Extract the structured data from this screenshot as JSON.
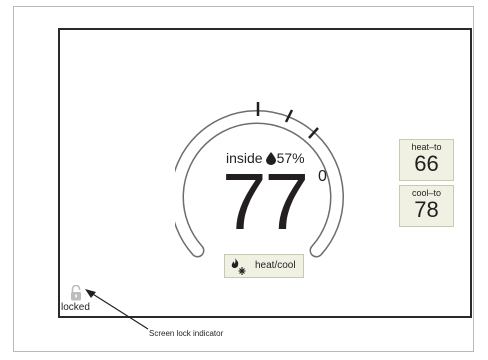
{
  "thermostat": {
    "inside_label": "inside",
    "humidity": "57%",
    "current_temp": "77",
    "temp_unit": "0",
    "heat_to": {
      "label": "heat–to",
      "value": "66"
    },
    "cool_to": {
      "label": "cool–to",
      "value": "78"
    },
    "mode": {
      "label": "heat/cool",
      "icon": "flame-snowflake-icon"
    }
  },
  "lock": {
    "label": "locked",
    "icon": "padlock-unlocked-icon"
  },
  "annotation": {
    "text": "Screen lock indicator"
  },
  "colors": {
    "button_fill": "#f1f1e3",
    "lock_icon": "#bdbdbd",
    "text": "#231f20"
  }
}
